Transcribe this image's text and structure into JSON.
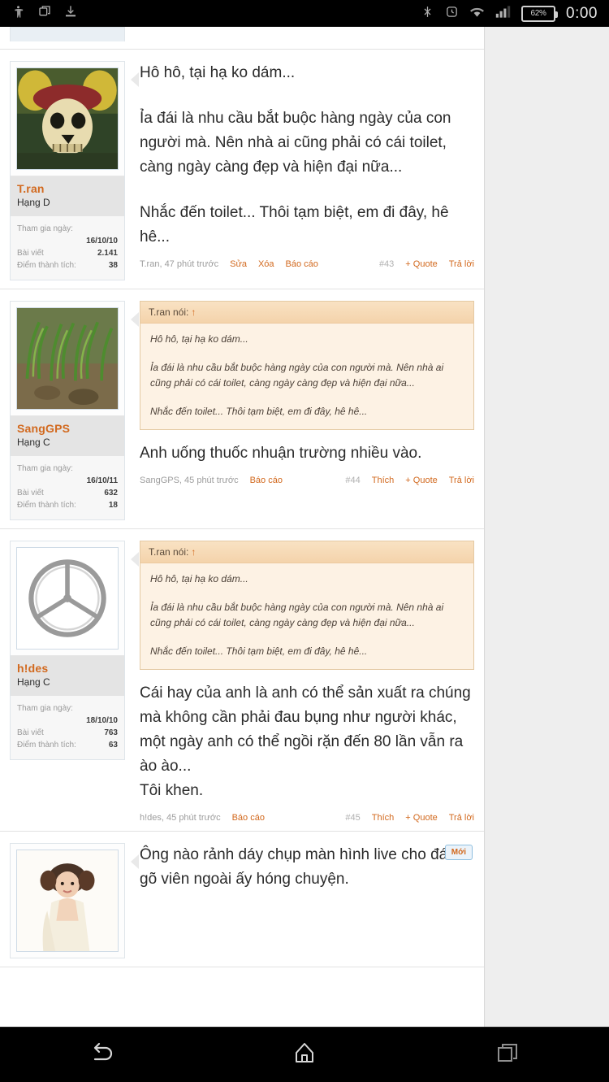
{
  "status_bar": {
    "left_icons": [
      "accessibility-icon",
      "screenshot-icon",
      "download-icon"
    ],
    "right_icons": [
      "bluetooth-off-icon",
      "alarm-icon",
      "wifi-icon",
      "signal-icon"
    ],
    "battery_text": "62%",
    "clock": "0:00"
  },
  "colors": {
    "accent": "#d2691e",
    "quote_bg": "#fdf2e4",
    "quote_head": "#f6d9b4",
    "page_bg": "#ffffff",
    "rail_bg": "#eeeeee"
  },
  "labels": {
    "edit": "Sửa",
    "delete": "Xóa",
    "report": "Báo cáo",
    "like": "Thích",
    "quote": "+ Quote",
    "reply": "Trả lời",
    "joined": "Tham gia ngày:",
    "posts": "Bài viết",
    "points": "Điểm thành tích:",
    "new_badge": "Mới"
  },
  "posts": [
    {
      "id": "post-43",
      "avatar": "pirate-skull-avatar",
      "username": "T.ran",
      "rank": "Hạng D",
      "joined_date": "16/10/10",
      "posts_count": "2.141",
      "points": "38",
      "quote": null,
      "paragraphs": [
        "Hô hô, tại hạ ko dám...",
        "Ỉa đái là nhu cầu bắt buộc hàng ngày của con người mà. Nên nhà ai cũng phải có cái toilet, càng ngày càng đẹp và hiện đại nữa...",
        "Nhắc đến toilet... Thôi tạm biệt, em đi đây, hê hê..."
      ],
      "meta": "T.ran, 47 phút trước",
      "actions": [
        "Sửa",
        "Xóa",
        "Báo cáo"
      ],
      "number": "#43",
      "right_actions": [
        "+ Quote",
        "Trả lời"
      ],
      "new_badge": false
    },
    {
      "id": "post-44",
      "avatar": "green-plants-avatar",
      "username": "SangGPS",
      "rank": "Hạng C",
      "joined_date": "16/10/11",
      "posts_count": "632",
      "points": "18",
      "quote": {
        "header": "T.ran nói:",
        "paragraphs": [
          "Hô hô, tại hạ ko dám...",
          "Ỉa đái là nhu cầu bắt buộc hàng ngày của con người mà. Nên nhà ai cũng phải có cái toilet, càng ngày càng đẹp và hiện đại nữa...",
          "Nhắc đến toilet... Thôi tạm biệt, em đi đây, hê hê..."
        ]
      },
      "paragraphs": [
        "Anh uống thuốc nhuận trường nhiều vào."
      ],
      "meta": "SangGPS, 45 phút trước",
      "actions": [
        "Báo cáo"
      ],
      "number": "#44",
      "right_actions": [
        "Thích",
        "+ Quote",
        "Trả lời"
      ],
      "new_badge": false
    },
    {
      "id": "post-45",
      "avatar": "mercedes-logo-avatar",
      "username": "h!des",
      "rank": "Hạng C",
      "joined_date": "18/10/10",
      "posts_count": "763",
      "points": "63",
      "quote": {
        "header": "T.ran nói:",
        "paragraphs": [
          "Hô hô, tại hạ ko dám...",
          "Ỉa đái là nhu cầu bắt buộc hàng ngày của con người mà. Nên nhà ai cũng phải có cái toilet, càng ngày càng đẹp và hiện đại nữa...",
          "Nhắc đến toilet... Thôi tạm biệt, em đi đây, hê hê..."
        ]
      },
      "paragraphs": [
        "Cái hay của anh là anh có thể sản xuất ra chúng mà không cần phải đau bụng như người khác, một ngày anh có thể ngồi rặn đến 80 lần vẫn ra ào ào...",
        "Tôi khen."
      ],
      "meta": "h!des, 45 phút trước",
      "actions": [
        "Báo cáo"
      ],
      "number": "#45",
      "right_actions": [
        "Thích",
        "+ Quote",
        "Trả lời"
      ],
      "new_badge": false
    },
    {
      "id": "post-46",
      "avatar": "girl-portrait-avatar",
      "username": "",
      "rank": "",
      "joined_date": "",
      "posts_count": "",
      "points": "",
      "quote": null,
      "paragraphs": [
        "Ông nào rảnh dáy chụp màn hình live cho đám gõ viên ngoài ấy hóng chuyện."
      ],
      "meta": "",
      "actions": [],
      "number": "",
      "right_actions": [],
      "new_badge": true
    }
  ],
  "nav_bar": {
    "back": "back-icon",
    "home": "home-icon",
    "recents": "recents-icon"
  }
}
